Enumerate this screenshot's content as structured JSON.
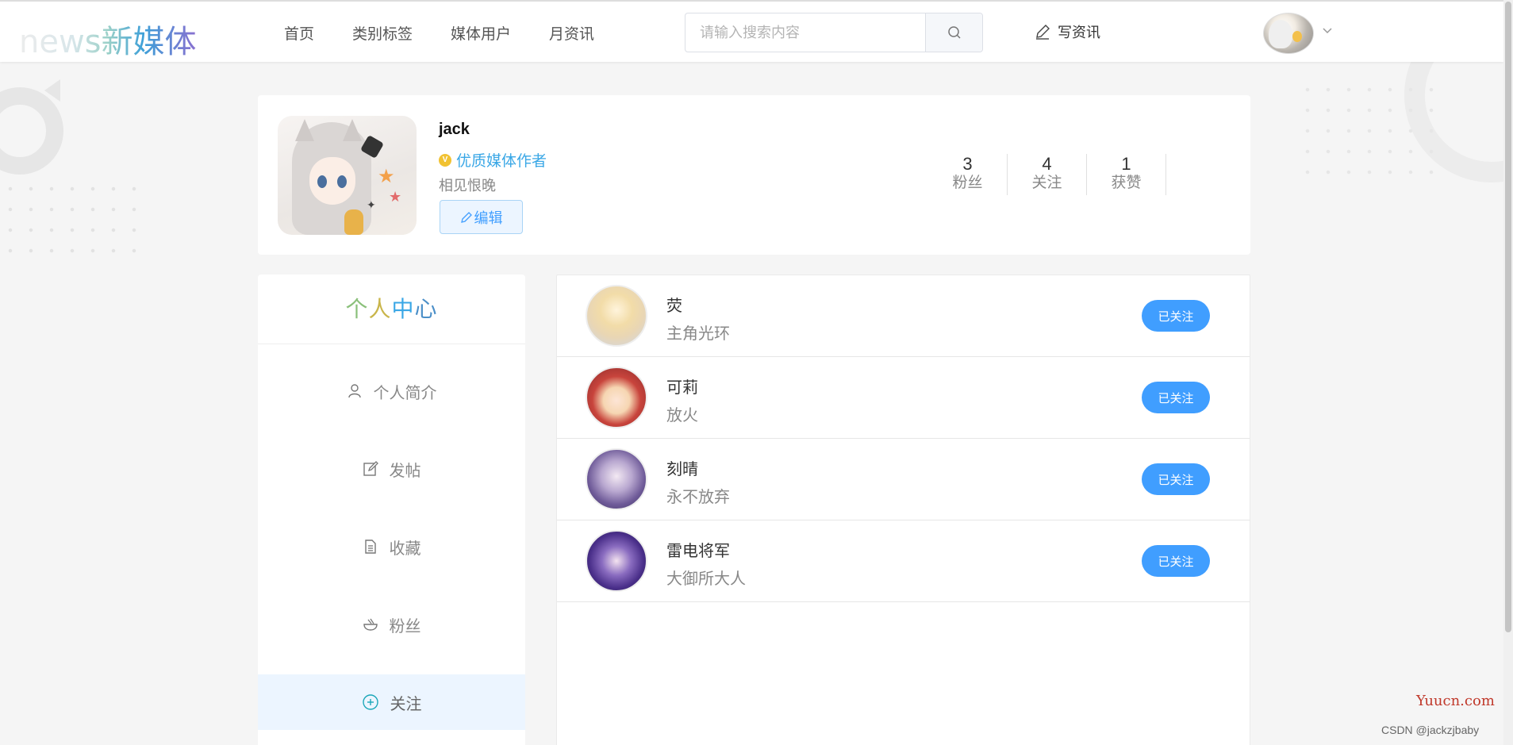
{
  "header": {
    "logo": "news新媒体",
    "nav": [
      "首页",
      "类别标签",
      "媒体用户",
      "月资讯"
    ],
    "search": {
      "placeholder": "请输入搜索内容",
      "value": ""
    },
    "write_label": "写资讯"
  },
  "profile": {
    "name": "jack",
    "verified_text": "优质媒体作者",
    "verified_badge": "V",
    "motto": "相见恨晚",
    "edit_label": "编辑",
    "stats": [
      {
        "value": "3",
        "label": "粉丝"
      },
      {
        "value": "4",
        "label": "关注"
      },
      {
        "value": "1",
        "label": "获赞"
      }
    ]
  },
  "sidebar": {
    "title": [
      "个",
      "人",
      "中",
      "心"
    ],
    "items": [
      {
        "label": "个人简介",
        "icon": "user-icon"
      },
      {
        "label": "发帖",
        "icon": "edit-square-icon"
      },
      {
        "label": "收藏",
        "icon": "document-icon"
      },
      {
        "label": "粉丝",
        "icon": "bowl-icon"
      },
      {
        "label": "关注",
        "icon": "circle-plus-icon",
        "active": true
      }
    ]
  },
  "follows": [
    {
      "name": "荧",
      "desc": "主角光环",
      "button": "已关注"
    },
    {
      "name": "可莉",
      "desc": "放火",
      "button": "已关注"
    },
    {
      "name": "刻晴",
      "desc": "永不放弃",
      "button": "已关注"
    },
    {
      "name": "雷电将军",
      "desc": "大御所大人",
      "button": "已关注"
    }
  ],
  "watermarks": {
    "site": "Yuucn.com",
    "csdn": "CSDN @jackzjbaby"
  },
  "colors": {
    "primary": "#409eff",
    "verified": "#3aa7e6",
    "badge": "#f1c232"
  }
}
